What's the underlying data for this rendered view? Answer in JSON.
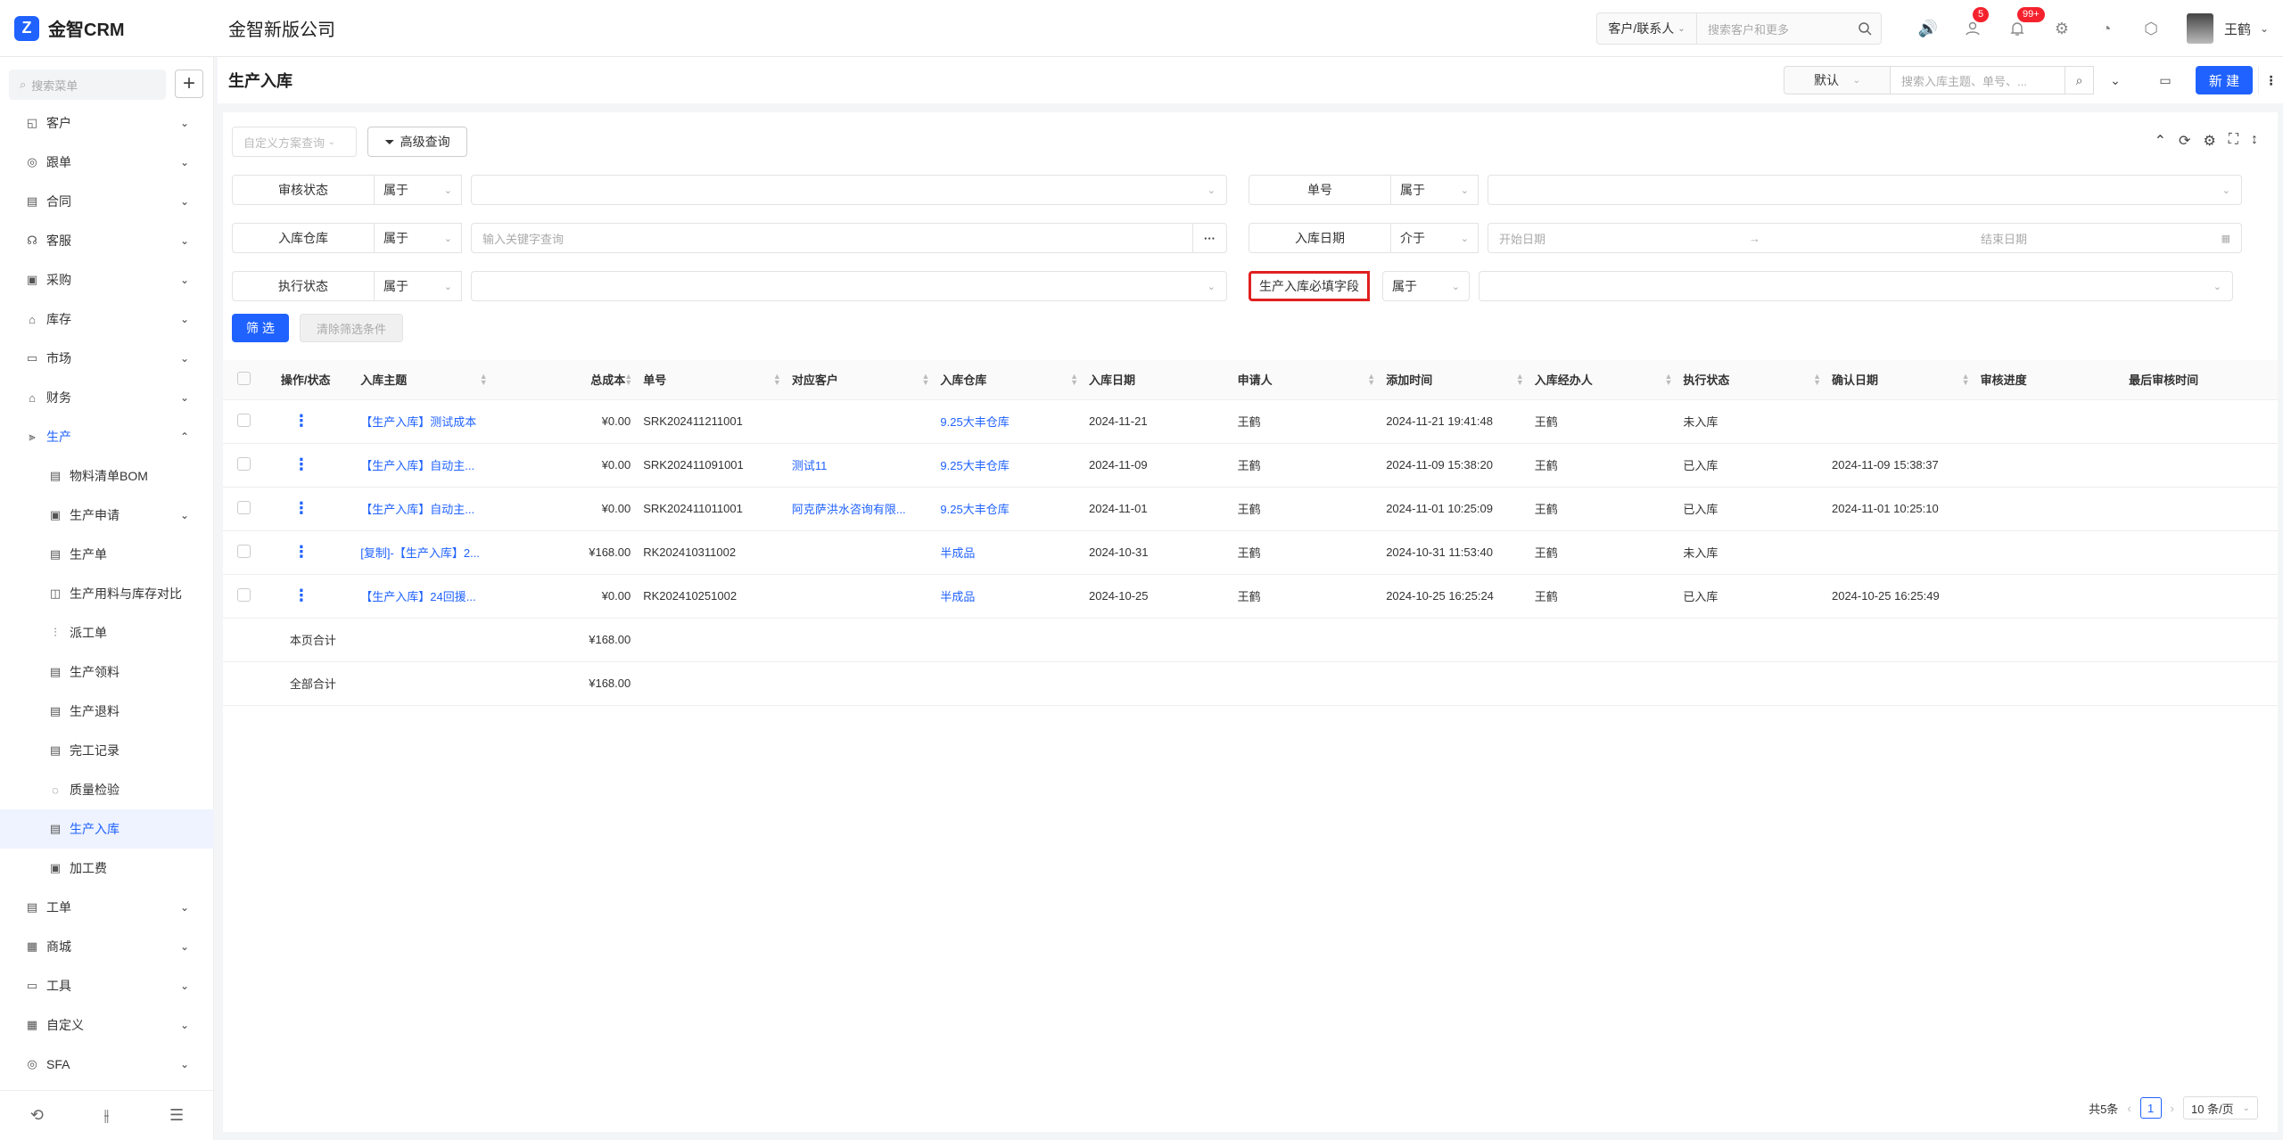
{
  "app": {
    "logo_mark": "Z",
    "name": "金智CRM",
    "company": "金智新版公司"
  },
  "topbar": {
    "search_select": "客户/联系人",
    "search_placeholder": "搜索客户和更多",
    "badge_contacts": "5",
    "badge_notice": "99+",
    "user_name": "王鹤"
  },
  "sidebar": {
    "search_placeholder": "搜索菜单",
    "items": [
      {
        "icon": "chart-icon",
        "glyph": "◱",
        "label": "客户",
        "chevron": "⌄"
      },
      {
        "icon": "target-icon",
        "glyph": "◎",
        "label": "跟单",
        "chevron": "⌄"
      },
      {
        "icon": "contract-icon",
        "glyph": "▤",
        "label": "合同",
        "chevron": "⌄"
      },
      {
        "icon": "service-icon",
        "glyph": "☊",
        "label": "客服",
        "chevron": "⌄"
      },
      {
        "icon": "purchase-icon",
        "glyph": "▣",
        "label": "采购",
        "chevron": "⌄"
      },
      {
        "icon": "warehouse-icon",
        "glyph": "⌂",
        "label": "库存",
        "chevron": "⌄"
      },
      {
        "icon": "market-icon",
        "glyph": "▭",
        "label": "市场",
        "chevron": "⌄"
      },
      {
        "icon": "finance-icon",
        "glyph": "⌂",
        "label": "财务",
        "chevron": "⌄"
      }
    ],
    "production": {
      "icon": "production-icon",
      "glyph": "⫸",
      "label": "生产",
      "chevron": "⌃"
    },
    "sub_items": [
      {
        "icon": "bom-icon",
        "glyph": "▤",
        "label": "物料清单BOM",
        "chevron": ""
      },
      {
        "icon": "apply-icon",
        "glyph": "▣",
        "label": "生产申请",
        "chevron": "⌄"
      },
      {
        "icon": "order-icon",
        "glyph": "▤",
        "label": "生产单",
        "chevron": ""
      },
      {
        "icon": "compare-icon",
        "glyph": "◫",
        "label": "生产用料与库存对比",
        "chevron": ""
      },
      {
        "icon": "dispatch-icon",
        "glyph": "⫶",
        "label": "派工单",
        "chevron": ""
      },
      {
        "icon": "pick-icon",
        "glyph": "▤",
        "label": "生产领料",
        "chevron": ""
      },
      {
        "icon": "return-icon",
        "glyph": "▤",
        "label": "生产退料",
        "chevron": ""
      },
      {
        "icon": "finish-icon",
        "glyph": "▤",
        "label": "完工记录",
        "chevron": ""
      },
      {
        "icon": "quality-icon",
        "glyph": "◌",
        "label": "质量检验",
        "chevron": ""
      },
      {
        "icon": "stockin-icon",
        "glyph": "▤",
        "label": "生产入库",
        "chevron": ""
      },
      {
        "icon": "process-fee-icon",
        "glyph": "▣",
        "label": "加工费",
        "chevron": ""
      }
    ],
    "bottom_items": [
      {
        "icon": "ticket-icon",
        "glyph": "▤",
        "label": "工单",
        "chevron": "⌄"
      },
      {
        "icon": "mall-icon",
        "glyph": "▦",
        "label": "商城",
        "chevron": "⌄"
      },
      {
        "icon": "tools-icon",
        "glyph": "▭",
        "label": "工具",
        "chevron": "⌄"
      },
      {
        "icon": "custom-icon",
        "glyph": "▦",
        "label": "自定义",
        "chevron": "⌄"
      },
      {
        "icon": "sfa-icon",
        "glyph": "◎",
        "label": "SFA",
        "chevron": "⌄"
      }
    ]
  },
  "page": {
    "title": "生产入库",
    "view_select": "默认",
    "search_placeholder": "搜索入库主题、单号、...",
    "new_button": "新 建"
  },
  "filters": {
    "custom_query_placeholder": "自定义方案查询",
    "advanced_query": "高级查询",
    "rows": [
      {
        "label": "审核状态",
        "op": "属于",
        "value": ""
      },
      {
        "label": "单号",
        "op": "属于",
        "value": ""
      },
      {
        "label": "入库仓库",
        "op": "属于",
        "value": "输入关键字查询"
      },
      {
        "label": "入库日期",
        "op": "介于",
        "start": "开始日期",
        "end": "结束日期"
      },
      {
        "label": "执行状态",
        "op": "属于",
        "value": ""
      },
      {
        "label": "生产入库必填字段",
        "op": "属于",
        "value": ""
      }
    ],
    "filter_button": "筛 选",
    "clear_button": "清除筛选条件"
  },
  "table": {
    "columns": [
      "操作/状态",
      "入库主题",
      "总成本",
      "单号",
      "对应客户",
      "入库仓库",
      "入库日期",
      "申请人",
      "添加时间",
      "入库经办人",
      "执行状态",
      "确认日期",
      "审核进度",
      "最后审核时间"
    ],
    "rows": [
      {
        "subject": "【生产入库】测试成本",
        "cost": "¥0.00",
        "no": "SRK202411211001",
        "customer": "",
        "warehouse": "9.25大丰仓库",
        "date": "2024-11-21",
        "applicant": "王鹤",
        "added": "2024-11-21 19:41:48",
        "handler": "王鹤",
        "status": "未入库",
        "confirm": "",
        "progress": "",
        "last_audit": ""
      },
      {
        "subject": "【生产入库】自动主...",
        "cost": "¥0.00",
        "no": "SRK202411091001",
        "customer": "测试11",
        "warehouse": "9.25大丰仓库",
        "date": "2024-11-09",
        "applicant": "王鹤",
        "added": "2024-11-09 15:38:20",
        "handler": "王鹤",
        "status": "已入库",
        "confirm": "2024-11-09 15:38:37",
        "progress": "",
        "last_audit": ""
      },
      {
        "subject": "【生产入库】自动主...",
        "cost": "¥0.00",
        "no": "SRK202411011001",
        "customer": "阿克萨洪水咨询有限...",
        "warehouse": "9.25大丰仓库",
        "date": "2024-11-01",
        "applicant": "王鹤",
        "added": "2024-11-01 10:25:09",
        "handler": "王鹤",
        "status": "已入库",
        "confirm": "2024-11-01 10:25:10",
        "progress": "",
        "last_audit": ""
      },
      {
        "subject": "[复制]-【生产入库】2...",
        "cost": "¥168.00",
        "no": "RK202410311002",
        "customer": "",
        "warehouse": "半成品",
        "date": "2024-10-31",
        "applicant": "王鹤",
        "added": "2024-10-31 11:53:40",
        "handler": "王鹤",
        "status": "未入库",
        "confirm": "",
        "progress": "",
        "last_audit": ""
      },
      {
        "subject": "【生产入库】24回援...",
        "cost": "¥0.00",
        "no": "RK202410251002",
        "customer": "",
        "warehouse": "半成品",
        "date": "2024-10-25",
        "applicant": "王鹤",
        "added": "2024-10-25 16:25:24",
        "handler": "王鹤",
        "status": "已入库",
        "confirm": "2024-10-25 16:25:49",
        "progress": "",
        "last_audit": ""
      }
    ],
    "page_total_label": "本页合计",
    "page_total": "¥168.00",
    "all_total_label": "全部合计",
    "all_total": "¥168.00"
  },
  "pagination": {
    "total": "共5条",
    "current": "1",
    "page_size": "10 条/页"
  }
}
